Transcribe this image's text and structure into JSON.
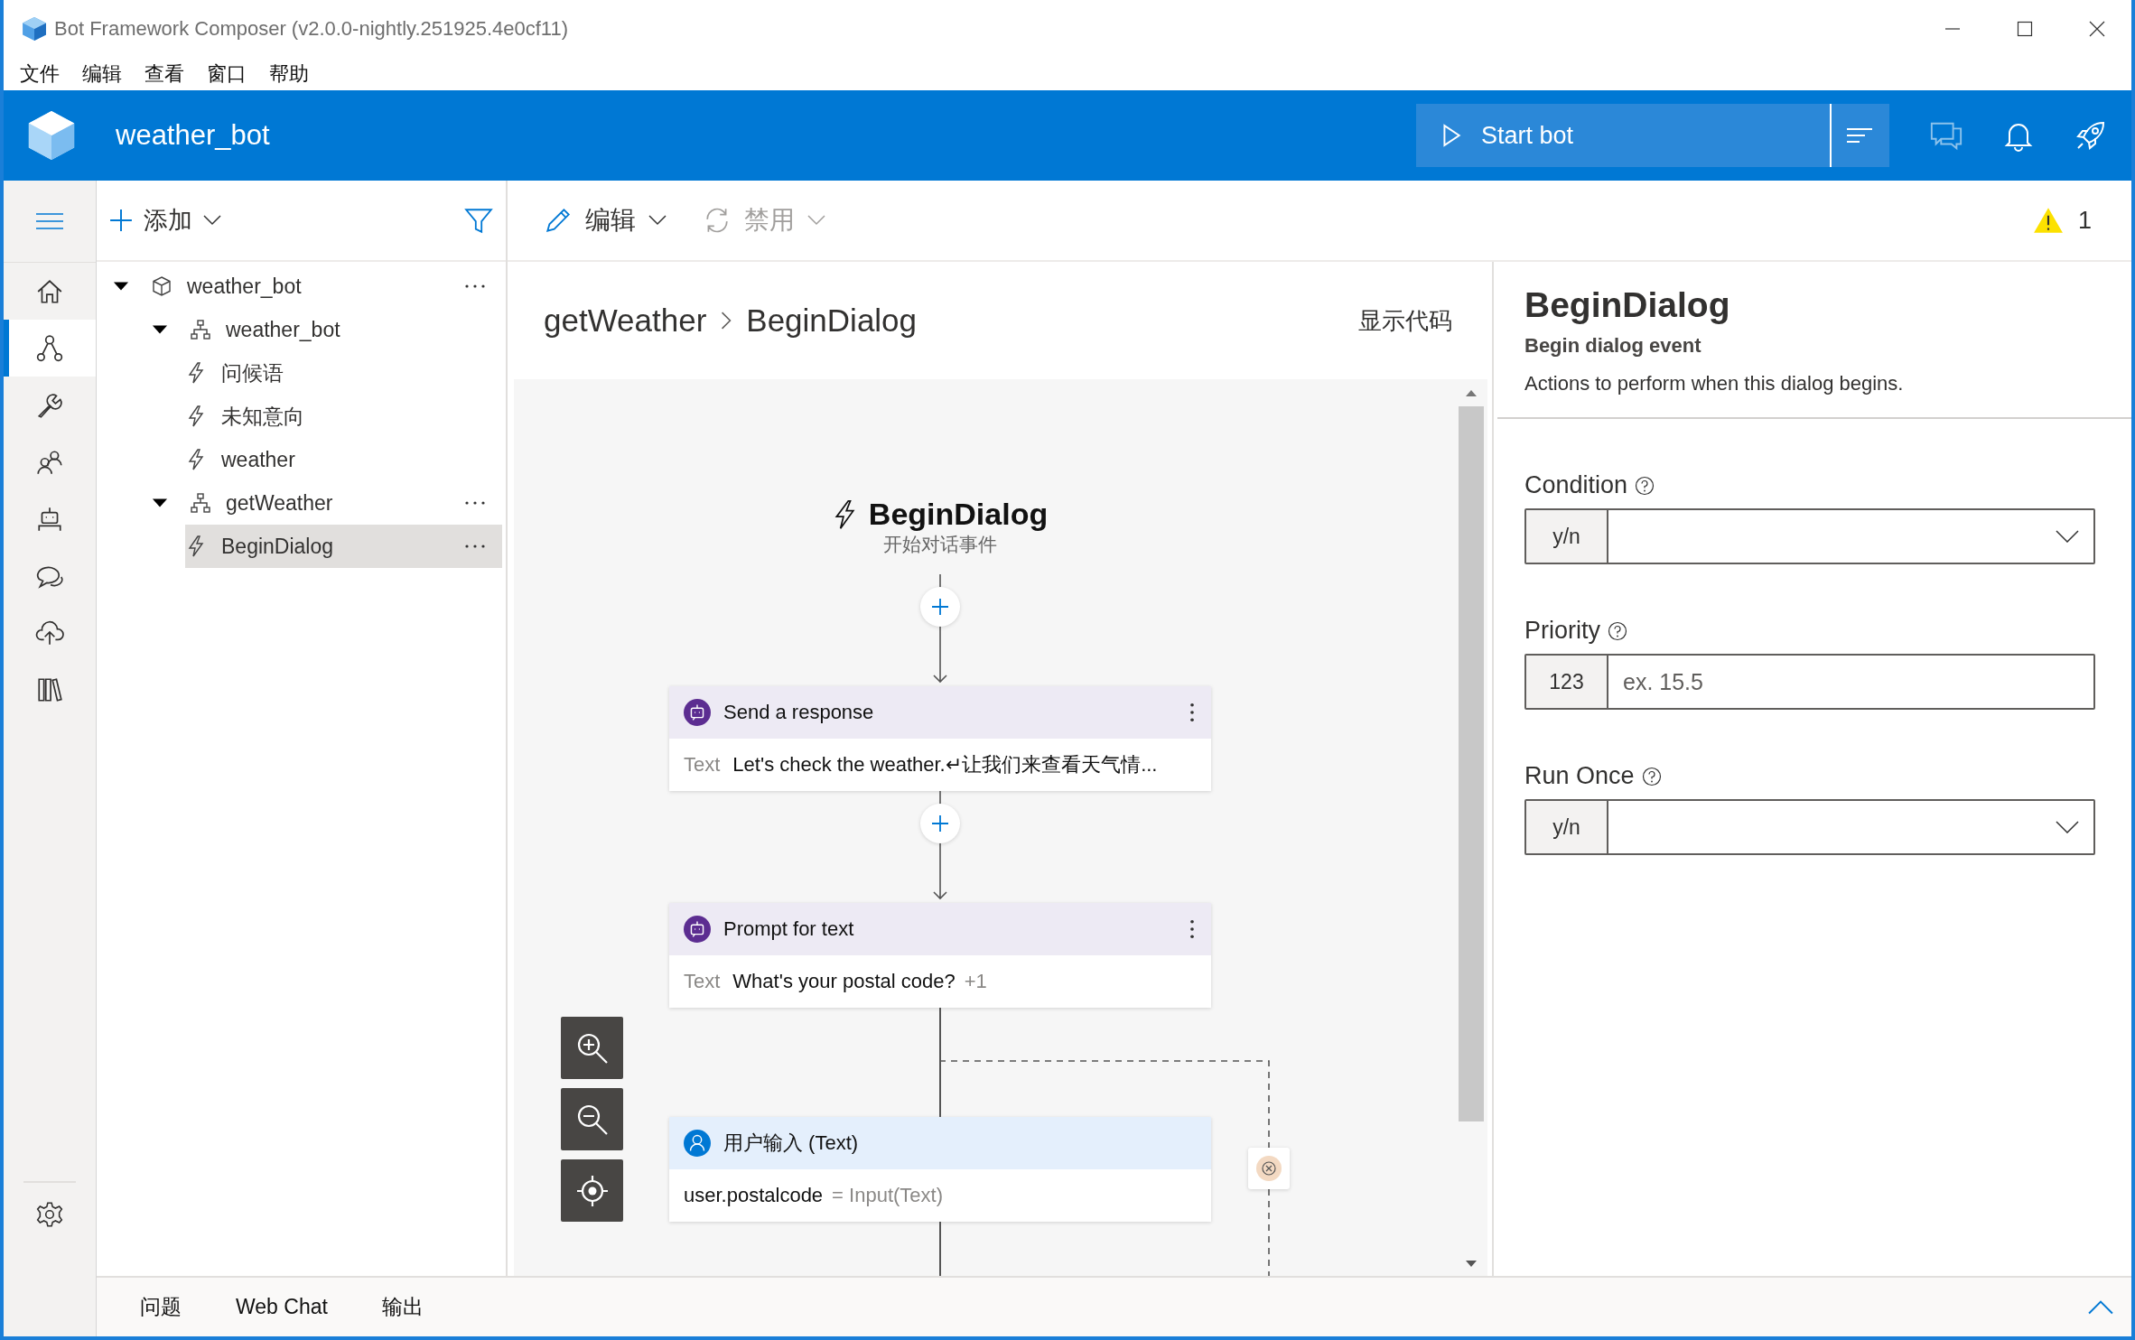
{
  "window": {
    "title": "Bot Framework Composer (v2.0.0-nightly.251925.4e0cf11)"
  },
  "menu": [
    "文件",
    "编辑",
    "查看",
    "窗口",
    "帮助"
  ],
  "header": {
    "project": "weather_bot",
    "start_bot": "Start bot"
  },
  "nav": {
    "items": [
      {
        "kind": "home",
        "selected": false
      },
      {
        "kind": "dialogs",
        "selected": true
      },
      {
        "kind": "config",
        "selected": false
      },
      {
        "kind": "users",
        "selected": false
      },
      {
        "kind": "bot",
        "selected": false
      },
      {
        "kind": "chat",
        "selected": false
      },
      {
        "kind": "publish",
        "selected": false
      },
      {
        "kind": "library",
        "selected": false
      }
    ],
    "footer": [
      {
        "kind": "settings",
        "selected": false
      }
    ]
  },
  "tree_toolbar": {
    "add": "添加"
  },
  "tree": [
    {
      "label": "weather_bot",
      "kind": "bot",
      "expanded": true,
      "selected": false,
      "menu": true,
      "children": [
        {
          "label": "weather_bot",
          "kind": "dialog",
          "expanded": true,
          "selected": false,
          "menu": false,
          "children": [
            {
              "label": "问候语",
              "kind": "trigger",
              "selected": false,
              "menu": false
            },
            {
              "label": "未知意向",
              "kind": "trigger",
              "selected": false,
              "menu": false
            },
            {
              "label": "weather",
              "kind": "trigger",
              "selected": false,
              "menu": false
            }
          ]
        },
        {
          "label": "getWeather",
          "kind": "dialog",
          "expanded": true,
          "selected": false,
          "menu": true,
          "children": [
            {
              "label": "BeginDialog",
              "kind": "trigger",
              "selected": true,
              "menu": true
            }
          ]
        }
      ]
    }
  ],
  "toolbar": [
    {
      "kind": "edit",
      "label": "编辑",
      "disabled": false
    },
    {
      "kind": "disable",
      "label": "禁用",
      "disabled": true
    }
  ],
  "warnings": "1",
  "breadcrumb": [
    "getWeather",
    "BeginDialog"
  ],
  "show_code": "显示代码",
  "flow": {
    "trigger": {
      "title": "BeginDialog",
      "subtitle": "开始对话事件"
    },
    "nodes": [
      {
        "kind": "response",
        "connector": {
          "kind": "add"
        },
        "title": "Send a response",
        "label": "Text",
        "value": "Let's check the weather.↵让我们来查看天气情..."
      },
      {
        "kind": "response",
        "connector": {
          "kind": "add"
        },
        "title": "Prompt for text",
        "label": "Text",
        "value": "What's your postal code?",
        "extra": "+1"
      },
      {
        "kind": "input",
        "connector": {
          "kind": "line"
        },
        "title": "用户输入 (Text)",
        "value": "user.postalcode",
        "suffix": "= Input(Text)"
      }
    ]
  },
  "properties": {
    "title": "BeginDialog",
    "subtitle": "Begin dialog event",
    "description": "Actions to perform when this dialog begins.",
    "fields": [
      {
        "kind": "dropdown",
        "label": "Condition",
        "prefix": "y/n"
      },
      {
        "kind": "number",
        "label": "Priority",
        "prefix": "123",
        "placeholder": "ex. 15.5"
      },
      {
        "kind": "dropdown",
        "label": "Run Once",
        "prefix": "y/n"
      }
    ]
  },
  "bottom_tabs": [
    "问题",
    "Web Chat",
    "输出"
  ]
}
